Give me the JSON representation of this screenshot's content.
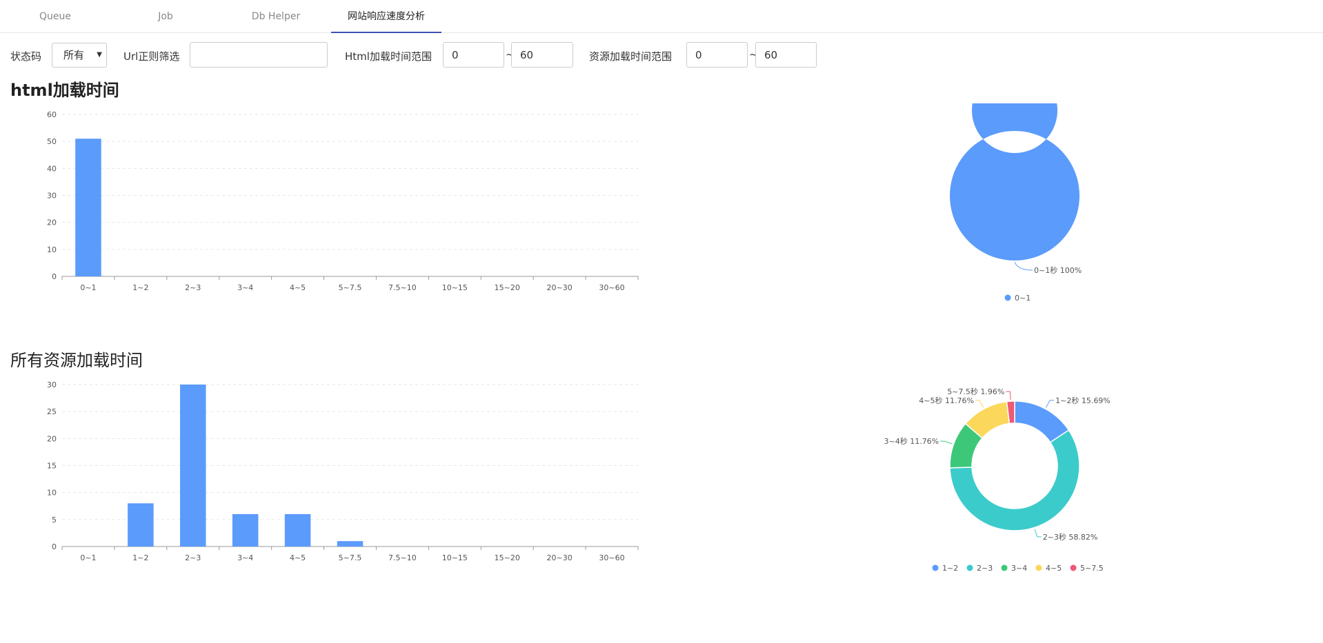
{
  "tabs": [
    {
      "label": "Queue",
      "active": false
    },
    {
      "label": "Job",
      "active": false
    },
    {
      "label": "Db Helper",
      "active": false
    },
    {
      "label": "网站响应速度分析",
      "active": true
    }
  ],
  "filters": {
    "status_label": "状态码",
    "status_value": "所有",
    "url_label": "Url正则筛选",
    "url_value": "",
    "html_range_label": "Html加载时间范围",
    "html_min": "0",
    "html_max": "60",
    "tilde": "~",
    "res_range_label": "资源加载时间范围",
    "res_min": "0",
    "res_max": "60"
  },
  "sections": {
    "html_title": "html加载时间",
    "res_title": "所有资源加载时间"
  },
  "colors": {
    "bar": "#5b9bfb",
    "palette": [
      "#5b9bfb",
      "#3ccbcb",
      "#3cc878",
      "#fbd75b",
      "#ee5a74"
    ]
  },
  "chart_data": [
    {
      "type": "bar",
      "categories": [
        "0~1",
        "1~2",
        "2~3",
        "3~4",
        "4~5",
        "5~7.5",
        "7.5~10",
        "10~15",
        "15~20",
        "20~30",
        "30~60"
      ],
      "values": [
        51,
        0,
        0,
        0,
        0,
        0,
        0,
        0,
        0,
        0,
        0
      ],
      "ylim": [
        0,
        60
      ],
      "yticks": [
        0,
        10,
        20,
        30,
        40,
        50,
        60
      ],
      "grid": true
    },
    {
      "type": "pie",
      "donut": true,
      "slices": [
        {
          "name": "0~1",
          "label": "0~1秒 100%",
          "value": 100
        }
      ],
      "legend": [
        "0~1"
      ],
      "legend_position": "bottom"
    },
    {
      "type": "bar",
      "categories": [
        "0~1",
        "1~2",
        "2~3",
        "3~4",
        "4~5",
        "5~7.5",
        "7.5~10",
        "10~15",
        "15~20",
        "20~30",
        "30~60"
      ],
      "values": [
        0,
        8,
        30,
        6,
        6,
        1,
        0,
        0,
        0,
        0,
        0
      ],
      "ylim": [
        0,
        30
      ],
      "yticks": [
        0,
        5,
        10,
        15,
        20,
        25,
        30
      ],
      "grid": true
    },
    {
      "type": "pie",
      "donut": true,
      "slices": [
        {
          "name": "1~2",
          "label": "1~2秒 15.69%",
          "value": 15.69
        },
        {
          "name": "2~3",
          "label": "2~3秒 58.82%",
          "value": 58.82
        },
        {
          "name": "3~4",
          "label": "3~4秒 11.76%",
          "value": 11.76
        },
        {
          "name": "4~5",
          "label": "4~5秒 11.76%",
          "value": 11.76
        },
        {
          "name": "5~7.5",
          "label": "5~7.5秒 1.96%",
          "value": 1.96
        }
      ],
      "legend": [
        "1~2",
        "2~3",
        "3~4",
        "4~5",
        "5~7.5"
      ],
      "legend_position": "bottom"
    }
  ]
}
